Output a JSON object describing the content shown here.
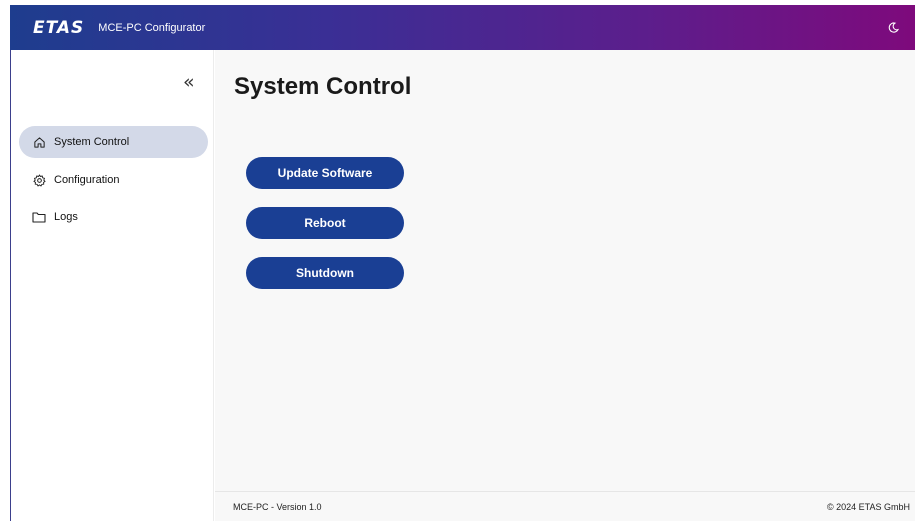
{
  "header": {
    "logo": "ETAS",
    "title": "MCE-PC Configurator",
    "theme_icon": "moon-icon"
  },
  "sidebar": {
    "collapse_icon": "«",
    "items": [
      {
        "label": "System Control",
        "icon": "home-icon",
        "active": true
      },
      {
        "label": "Configuration",
        "icon": "gear-icon",
        "active": false
      },
      {
        "label": "Logs",
        "icon": "folder-icon",
        "active": false
      }
    ]
  },
  "main": {
    "title": "System Control",
    "buttons": [
      {
        "label": "Update Software"
      },
      {
        "label": "Reboot"
      },
      {
        "label": "Shutdown"
      }
    ]
  },
  "footer": {
    "version": "MCE-PC - Version 1.0",
    "copyright": "© 2024 ETAS GmbH"
  },
  "colors": {
    "primary_button": "#1a3f94",
    "header_start": "#1e3d8e",
    "header_end": "#7e0a7c",
    "active_nav": "#d3d9e8"
  }
}
